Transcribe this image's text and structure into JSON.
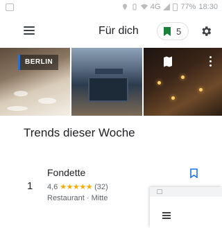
{
  "status_bar": {
    "network": "4G",
    "battery": "77%",
    "time": "18:30"
  },
  "app_bar": {
    "title": "Für dich",
    "saved_count": "5",
    "icons": [
      "menu-icon",
      "bookmark-icon",
      "gear-icon"
    ]
  },
  "photos": {
    "city_label": "BERLIN",
    "icons": [
      "map-icon",
      "more-vert-icon"
    ]
  },
  "trends": {
    "heading": "Trends dieser Woche",
    "items": [
      {
        "rank": "1",
        "name": "Fondette",
        "rating": "4,6",
        "stars": "★★★★★",
        "reviews": "(32)",
        "subtitle": "Restaurant · Mitte"
      }
    ]
  },
  "colors": {
    "accent_green": "#188038",
    "accent_blue": "#1a73e8",
    "star": "#f9ab00"
  }
}
